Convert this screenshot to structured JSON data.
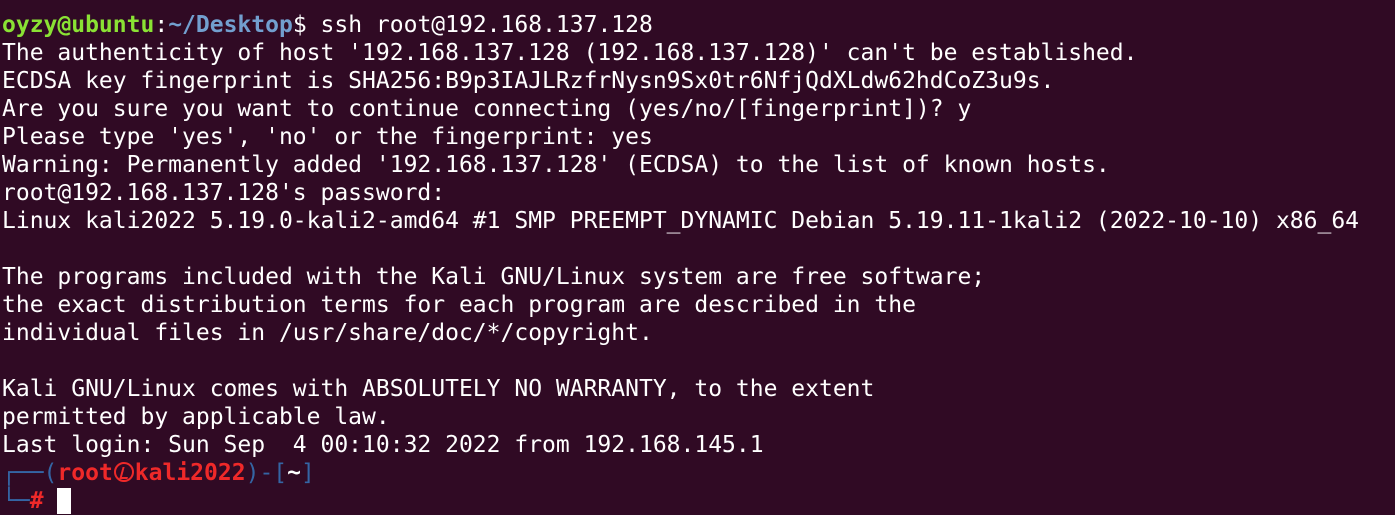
{
  "prompt": {
    "user_host": "oyzy@ubuntu",
    "colon": ":",
    "path": "~/Desktop",
    "dollar": "$",
    "command": " ssh root@192.168.137.128"
  },
  "output": [
    "The authenticity of host '192.168.137.128 (192.168.137.128)' can't be established.",
    "ECDSA key fingerprint is SHA256:B9p3IAJLRzfrNysn9Sx0tr6NfjQdXLdw62hdCoZ3u9s.",
    "Are you sure you want to continue connecting (yes/no/[fingerprint])? y",
    "Please type 'yes', 'no' or the fingerprint: yes",
    "Warning: Permanently added '192.168.137.128' (ECDSA) to the list of known hosts.",
    "root@192.168.137.128's password: ",
    "Linux kali2022 5.19.0-kali2-amd64 #1 SMP PREEMPT_DYNAMIC Debian 5.19.11-1kali2 (2022-10-10) x86_64",
    "",
    "The programs included with the Kali GNU/Linux system are free software;",
    "the exact distribution terms for each program are described in the",
    "individual files in /usr/share/doc/*/copyright.",
    "",
    "Kali GNU/Linux comes with ABSOLUTELY NO WARRANTY, to the extent",
    "permitted by applicable law.",
    "Last login: Sun Sep  4 00:10:32 2022 from 192.168.145.1"
  ],
  "kali_prompt": {
    "top_frame": "┌──",
    "open_paren": "(",
    "user": "root",
    "skull_icon": "kali-skull-icon",
    "host": "kali2022",
    "close_paren": ")",
    "dash": "-",
    "open_bracket": "[",
    "dir": "~",
    "close_bracket": "]",
    "bottom_frame": "└─",
    "hash": "#"
  },
  "colors": {
    "background": "#300a24",
    "user_host": "#8ae234",
    "path": "#729fcf",
    "kali_frame": "#3465a4",
    "kali_red": "#ef2929"
  }
}
